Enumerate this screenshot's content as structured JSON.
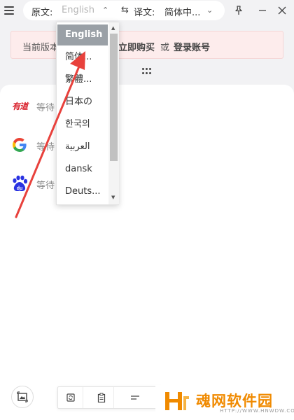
{
  "header": {
    "source_label": "原文:",
    "source_value": "English",
    "swap_icon": "swap-icon",
    "target_label": "译文:",
    "target_value": "简体中..."
  },
  "window_controls": [
    "pin-icon",
    "minimize-icon",
    "close-icon"
  ],
  "notice": {
    "prefix": "当前版本",
    "buy_link": "立即购买",
    "or": "或",
    "login_link": "登录账号"
  },
  "engines": [
    {
      "name": "youdao",
      "logo_text": "有道",
      "status": "等待"
    },
    {
      "name": "google",
      "logo_text": "G",
      "status": "等待"
    },
    {
      "name": "baidu",
      "logo_text": "du",
      "status": "等待"
    }
  ],
  "dropdown": {
    "items": [
      "English",
      "简体...",
      "繁體...",
      "日本の",
      "한국의",
      "العربية",
      "dansk",
      "Deuts..."
    ],
    "selected": "English"
  },
  "toolbar": [
    "refresh-icon",
    "clipboard-icon",
    "text-lines-icon"
  ],
  "watermark": {
    "title": "魂网软件园",
    "url": "HTTP://WWW.HNWDW.COM"
  },
  "colors": {
    "accent_red": "#e8413c",
    "notice_bg": "#fdecec",
    "selected_item": "#9aa0a6",
    "watermark_orange": "#f08a00"
  }
}
